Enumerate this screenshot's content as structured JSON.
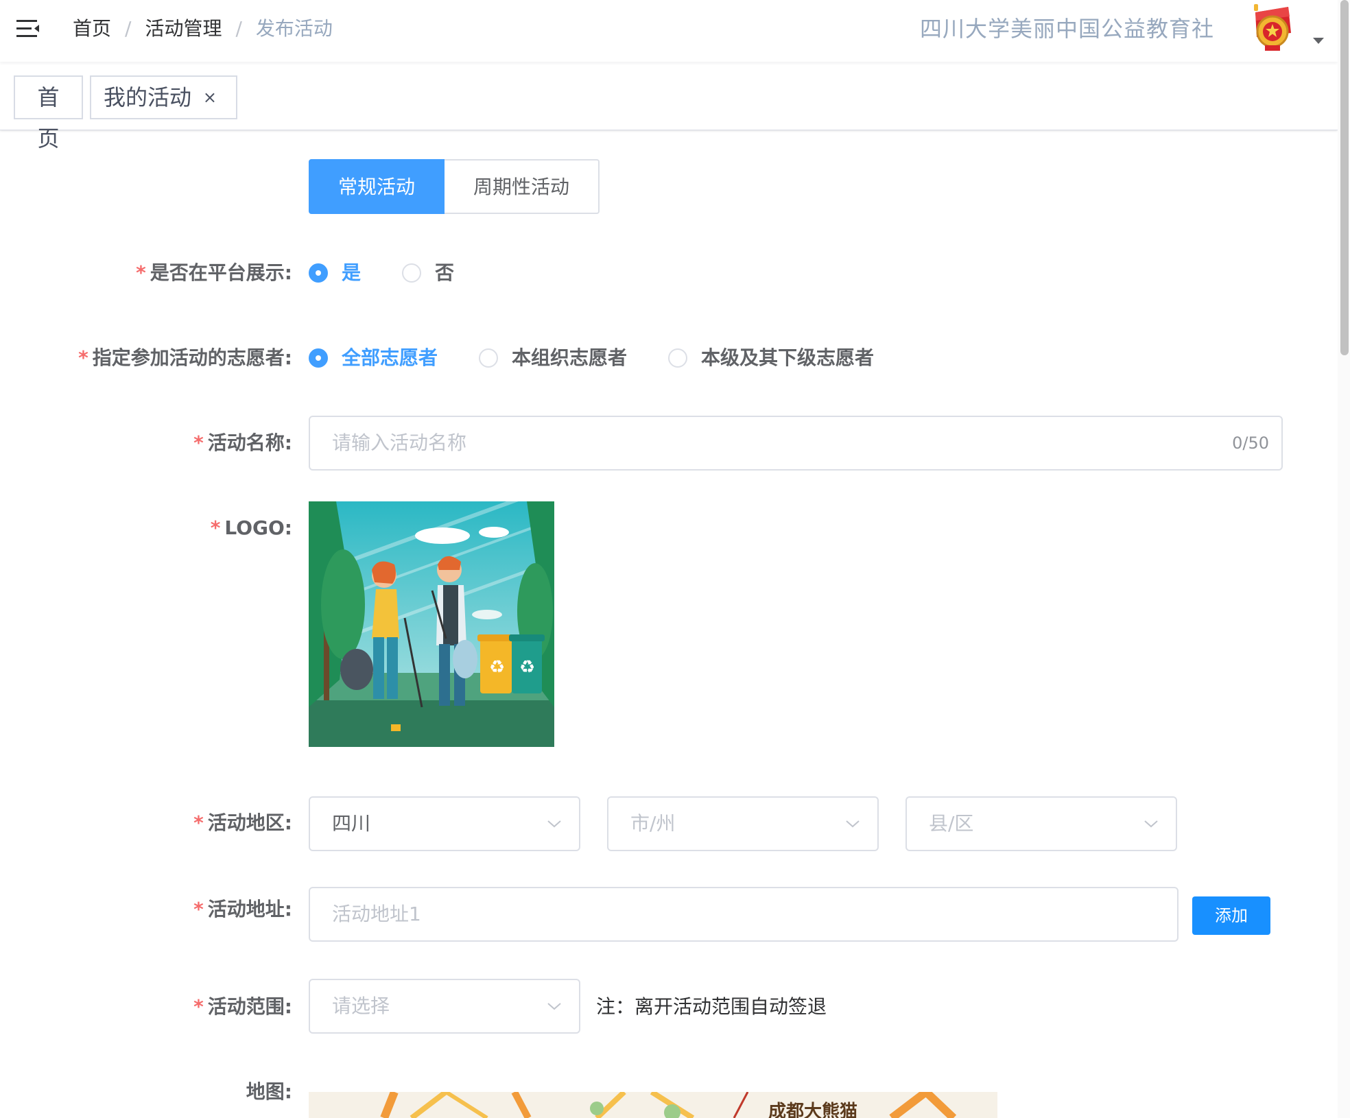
{
  "header": {
    "breadcrumb": [
      "首页",
      "活动管理",
      "发布活动"
    ],
    "breadcrumb_separator": "/",
    "org_name": "四川大学美丽中国公益教育社",
    "menu_icon": "hamburger-fold-icon",
    "avatar_icon": "youth-league-emblem-icon"
  },
  "tags": {
    "home": "首页",
    "mine": "我的活动",
    "close_glyph": "×"
  },
  "segment": {
    "tabs": [
      "常规活动",
      "周期性活动"
    ],
    "active_index": 0
  },
  "form": {
    "show_on_platform": {
      "label": "是否在平台展示:",
      "options": [
        "是",
        "否"
      ],
      "selected": "是"
    },
    "volunteers": {
      "label": "指定参加活动的志愿者:",
      "options": [
        "全部志愿者",
        "本组织志愿者",
        "本级及其下级志愿者"
      ],
      "selected": "全部志愿者"
    },
    "name": {
      "label": "活动名称:",
      "placeholder": "请输入活动名称",
      "counter": "0/50"
    },
    "logo": {
      "label": "LOGO:",
      "image": "volunteers-cleaning-park-illustration"
    },
    "region": {
      "label": "活动地区:",
      "province": "四川",
      "city_placeholder": "市/州",
      "district_placeholder": "县/区"
    },
    "address": {
      "label": "活动地址:",
      "placeholder": "活动地址1",
      "add_button": "添加"
    },
    "range": {
      "label": "活动范围:",
      "placeholder": "请选择",
      "note": "注：离开活动范围自动签退"
    },
    "map": {
      "label": "地图:",
      "visible_text": "成都大熊猫"
    }
  },
  "colors": {
    "primary": "#409eff",
    "required_star": "#f56c6c",
    "placeholder": "#c0c4cc"
  }
}
